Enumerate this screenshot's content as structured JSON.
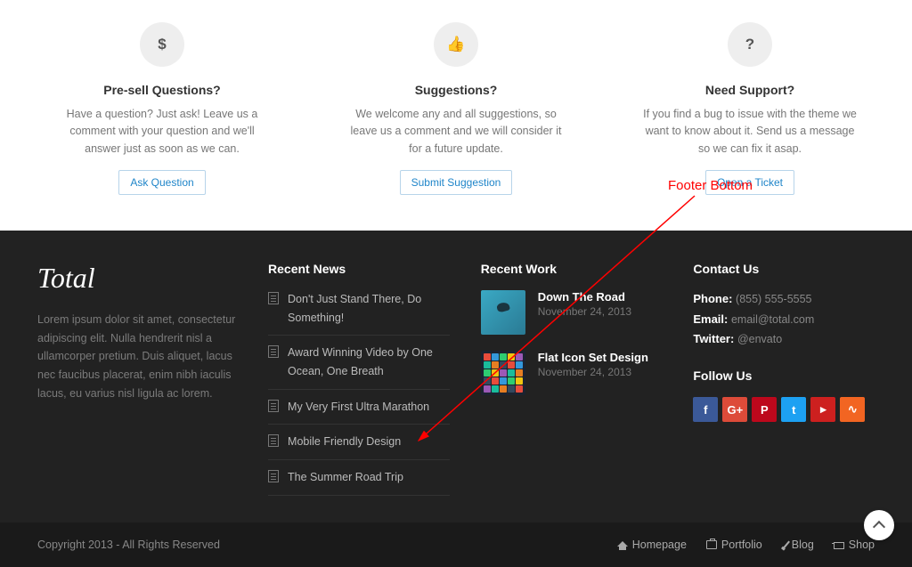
{
  "annotation": {
    "label": "Footer Bottom"
  },
  "features": [
    {
      "icon": "$",
      "title": "Pre-sell Questions?",
      "desc": "Have a question? Just ask! Leave us a comment with your question and we'll answer just as soon as we can.",
      "button": "Ask Question"
    },
    {
      "icon": "👍",
      "title": "Suggestions?",
      "desc": "We welcome any and all suggestions, so leave us a comment and we will consider it for a future update.",
      "button": "Submit Suggestion"
    },
    {
      "icon": "?",
      "title": "Need Support?",
      "desc": "If you find a bug to issue with the theme we want to know about it. Send us a message so we can fix it asap.",
      "button": "Open a Ticket"
    }
  ],
  "footer": {
    "logo": "Total",
    "about": "Lorem ipsum dolor sit amet, consectetur adipiscing elit. Nulla hendrerit nisl a ullamcorper pretium. Duis aliquet, lacus nec faucibus placerat, enim nibh iaculis lacus, eu varius nisl ligula ac lorem.",
    "news_heading": "Recent News",
    "news": [
      "Don't Just Stand There, Do Something!",
      "Award Winning Video by One Ocean, One Breath",
      "My Very First Ultra Marathon",
      "Mobile Friendly Design",
      "The Summer Road Trip"
    ],
    "work_heading": "Recent Work",
    "work": [
      {
        "title": "Down The Road",
        "date": "November 24, 2013"
      },
      {
        "title": "Flat Icon Set Design",
        "date": "November 24, 2013"
      }
    ],
    "contact_heading": "Contact Us",
    "contact": {
      "phone_label": "Phone:",
      "phone": "(855) 555-5555",
      "email_label": "Email:",
      "email": "email@total.com",
      "twitter_label": "Twitter:",
      "twitter": "@envato"
    },
    "follow_heading": "Follow Us",
    "social": {
      "fb": "f",
      "gp": "G+",
      "pin": "P",
      "tw": "t",
      "yt": "▸",
      "rss": "∿"
    }
  },
  "bottom": {
    "copyright": "Copyright 2013 - All Rights Reserved",
    "nav": [
      {
        "icon": "home",
        "label": "Homepage"
      },
      {
        "icon": "portfolio",
        "label": "Portfolio"
      },
      {
        "icon": "blog",
        "label": "Blog"
      },
      {
        "icon": "shop",
        "label": "Shop"
      }
    ]
  }
}
